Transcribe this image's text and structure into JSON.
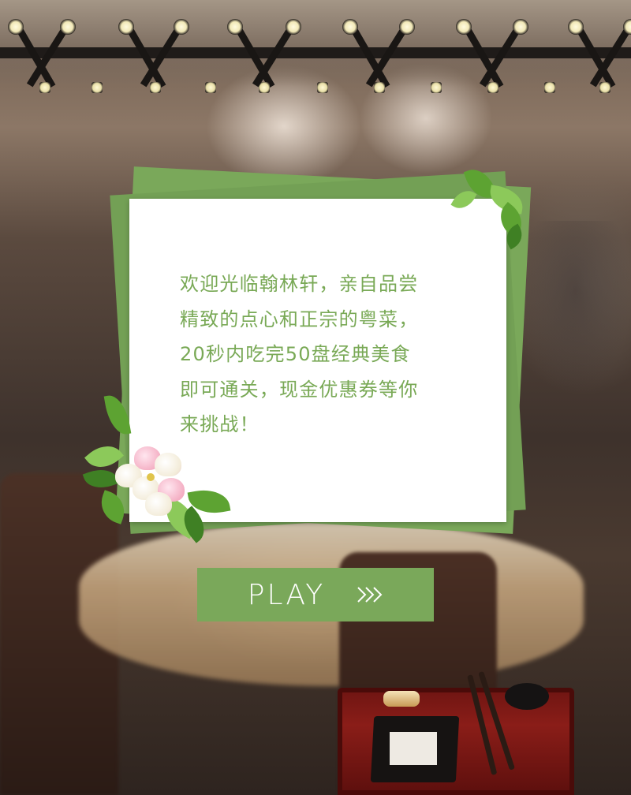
{
  "intro": {
    "lines": [
      "欢迎光临翰林轩，亲自品尝",
      "精致的点心和正宗的粤菜，",
      "20秒内吃完50盘经典美食",
      "即可通关，现金优惠券等你",
      "来挑战！"
    ]
  },
  "play_button": {
    "label": "PLAY",
    "icon": "double-chevron-right-icon"
  },
  "colors": {
    "accent_green": "#7aa85a",
    "text_green": "#79a956",
    "button_text": "#ffffff"
  }
}
